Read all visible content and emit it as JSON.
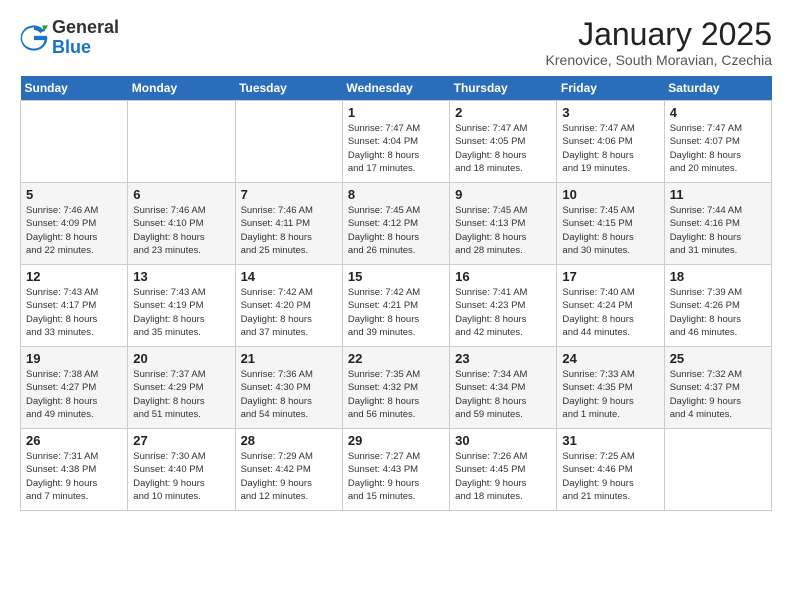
{
  "header": {
    "logo_general": "General",
    "logo_blue": "Blue",
    "month_title": "January 2025",
    "location": "Krenovice, South Moravian, Czechia"
  },
  "weekdays": [
    "Sunday",
    "Monday",
    "Tuesday",
    "Wednesday",
    "Thursday",
    "Friday",
    "Saturday"
  ],
  "weeks": [
    [
      {
        "day": "",
        "info": ""
      },
      {
        "day": "",
        "info": ""
      },
      {
        "day": "",
        "info": ""
      },
      {
        "day": "1",
        "info": "Sunrise: 7:47 AM\nSunset: 4:04 PM\nDaylight: 8 hours\nand 17 minutes."
      },
      {
        "day": "2",
        "info": "Sunrise: 7:47 AM\nSunset: 4:05 PM\nDaylight: 8 hours\nand 18 minutes."
      },
      {
        "day": "3",
        "info": "Sunrise: 7:47 AM\nSunset: 4:06 PM\nDaylight: 8 hours\nand 19 minutes."
      },
      {
        "day": "4",
        "info": "Sunrise: 7:47 AM\nSunset: 4:07 PM\nDaylight: 8 hours\nand 20 minutes."
      }
    ],
    [
      {
        "day": "5",
        "info": "Sunrise: 7:46 AM\nSunset: 4:09 PM\nDaylight: 8 hours\nand 22 minutes."
      },
      {
        "day": "6",
        "info": "Sunrise: 7:46 AM\nSunset: 4:10 PM\nDaylight: 8 hours\nand 23 minutes."
      },
      {
        "day": "7",
        "info": "Sunrise: 7:46 AM\nSunset: 4:11 PM\nDaylight: 8 hours\nand 25 minutes."
      },
      {
        "day": "8",
        "info": "Sunrise: 7:45 AM\nSunset: 4:12 PM\nDaylight: 8 hours\nand 26 minutes."
      },
      {
        "day": "9",
        "info": "Sunrise: 7:45 AM\nSunset: 4:13 PM\nDaylight: 8 hours\nand 28 minutes."
      },
      {
        "day": "10",
        "info": "Sunrise: 7:45 AM\nSunset: 4:15 PM\nDaylight: 8 hours\nand 30 minutes."
      },
      {
        "day": "11",
        "info": "Sunrise: 7:44 AM\nSunset: 4:16 PM\nDaylight: 8 hours\nand 31 minutes."
      }
    ],
    [
      {
        "day": "12",
        "info": "Sunrise: 7:43 AM\nSunset: 4:17 PM\nDaylight: 8 hours\nand 33 minutes."
      },
      {
        "day": "13",
        "info": "Sunrise: 7:43 AM\nSunset: 4:19 PM\nDaylight: 8 hours\nand 35 minutes."
      },
      {
        "day": "14",
        "info": "Sunrise: 7:42 AM\nSunset: 4:20 PM\nDaylight: 8 hours\nand 37 minutes."
      },
      {
        "day": "15",
        "info": "Sunrise: 7:42 AM\nSunset: 4:21 PM\nDaylight: 8 hours\nand 39 minutes."
      },
      {
        "day": "16",
        "info": "Sunrise: 7:41 AM\nSunset: 4:23 PM\nDaylight: 8 hours\nand 42 minutes."
      },
      {
        "day": "17",
        "info": "Sunrise: 7:40 AM\nSunset: 4:24 PM\nDaylight: 8 hours\nand 44 minutes."
      },
      {
        "day": "18",
        "info": "Sunrise: 7:39 AM\nSunset: 4:26 PM\nDaylight: 8 hours\nand 46 minutes."
      }
    ],
    [
      {
        "day": "19",
        "info": "Sunrise: 7:38 AM\nSunset: 4:27 PM\nDaylight: 8 hours\nand 49 minutes."
      },
      {
        "day": "20",
        "info": "Sunrise: 7:37 AM\nSunset: 4:29 PM\nDaylight: 8 hours\nand 51 minutes."
      },
      {
        "day": "21",
        "info": "Sunrise: 7:36 AM\nSunset: 4:30 PM\nDaylight: 8 hours\nand 54 minutes."
      },
      {
        "day": "22",
        "info": "Sunrise: 7:35 AM\nSunset: 4:32 PM\nDaylight: 8 hours\nand 56 minutes."
      },
      {
        "day": "23",
        "info": "Sunrise: 7:34 AM\nSunset: 4:34 PM\nDaylight: 8 hours\nand 59 minutes."
      },
      {
        "day": "24",
        "info": "Sunrise: 7:33 AM\nSunset: 4:35 PM\nDaylight: 9 hours\nand 1 minute."
      },
      {
        "day": "25",
        "info": "Sunrise: 7:32 AM\nSunset: 4:37 PM\nDaylight: 9 hours\nand 4 minutes."
      }
    ],
    [
      {
        "day": "26",
        "info": "Sunrise: 7:31 AM\nSunset: 4:38 PM\nDaylight: 9 hours\nand 7 minutes."
      },
      {
        "day": "27",
        "info": "Sunrise: 7:30 AM\nSunset: 4:40 PM\nDaylight: 9 hours\nand 10 minutes."
      },
      {
        "day": "28",
        "info": "Sunrise: 7:29 AM\nSunset: 4:42 PM\nDaylight: 9 hours\nand 12 minutes."
      },
      {
        "day": "29",
        "info": "Sunrise: 7:27 AM\nSunset: 4:43 PM\nDaylight: 9 hours\nand 15 minutes."
      },
      {
        "day": "30",
        "info": "Sunrise: 7:26 AM\nSunset: 4:45 PM\nDaylight: 9 hours\nand 18 minutes."
      },
      {
        "day": "31",
        "info": "Sunrise: 7:25 AM\nSunset: 4:46 PM\nDaylight: 9 hours\nand 21 minutes."
      },
      {
        "day": "",
        "info": ""
      }
    ]
  ]
}
